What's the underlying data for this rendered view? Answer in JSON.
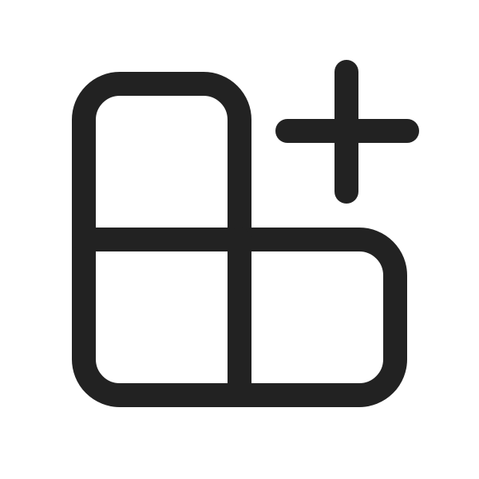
{
  "icon": {
    "name": "apps-add-icon",
    "stroke_color": "#222222",
    "background_color": "#ffffff"
  }
}
